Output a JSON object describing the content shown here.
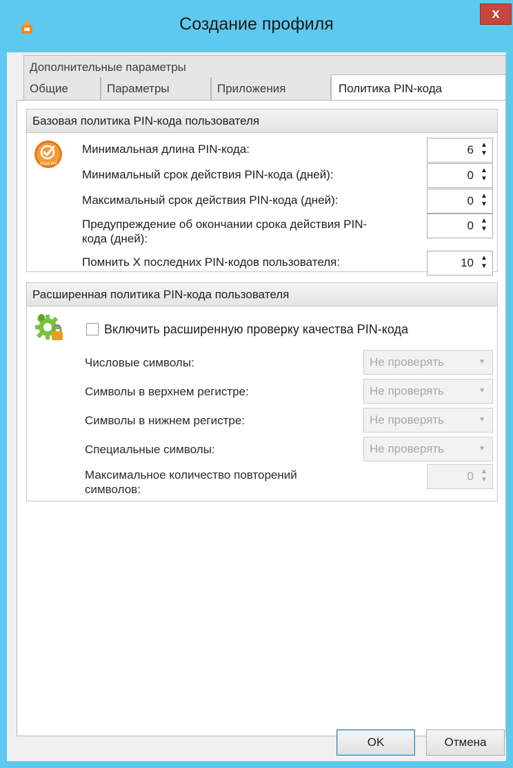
{
  "window": {
    "title": "Создание профиля",
    "close_label": "x"
  },
  "tabs": {
    "top_row": "Дополнительные параметры",
    "items": [
      {
        "label": "Общие"
      },
      {
        "label": "Параметры"
      },
      {
        "label": "Приложения"
      },
      {
        "label": "Политика PIN-кода"
      }
    ],
    "active": "Политика PIN-кода"
  },
  "basic_policy": {
    "header": "Базовая политика PIN-кода пользователя",
    "icon_caption": "Quick PIN",
    "rows": [
      {
        "label": "Минимальная длина PIN-кода:",
        "value": "6"
      },
      {
        "label": "Минимальный срок действия PIN-кода (дней):",
        "value": "0"
      },
      {
        "label": "Максимальный срок действия PIN-кода (дней):",
        "value": "0"
      },
      {
        "label": "Предупреждение об окончании срока действия PIN-кода (дней):",
        "value": "0"
      },
      {
        "label": "Помнить X последних PIN-кодов пользователя:",
        "value": "10"
      }
    ]
  },
  "advanced_policy": {
    "header": "Расширенная политика PIN-кода пользователя",
    "checkbox_label": "Включить расширенную проверку качества PIN-кода",
    "checkbox_checked": false,
    "rows": [
      {
        "label": "Числовые символы:",
        "value": "Не проверять"
      },
      {
        "label": "Символы в верхнем регистре:",
        "value": "Не проверять"
      },
      {
        "label": "Символы в нижнем регистре:",
        "value": "Не проверять"
      },
      {
        "label": "Специальные символы:",
        "value": "Не проверять"
      }
    ],
    "max_repeat_label": "Максимальное количество повторений символов:",
    "max_repeat_value": "0"
  },
  "buttons": {
    "ok": "OK",
    "cancel": "Отмена"
  },
  "colors": {
    "titlebar": "#5ec9ee",
    "close": "#c7463e"
  }
}
